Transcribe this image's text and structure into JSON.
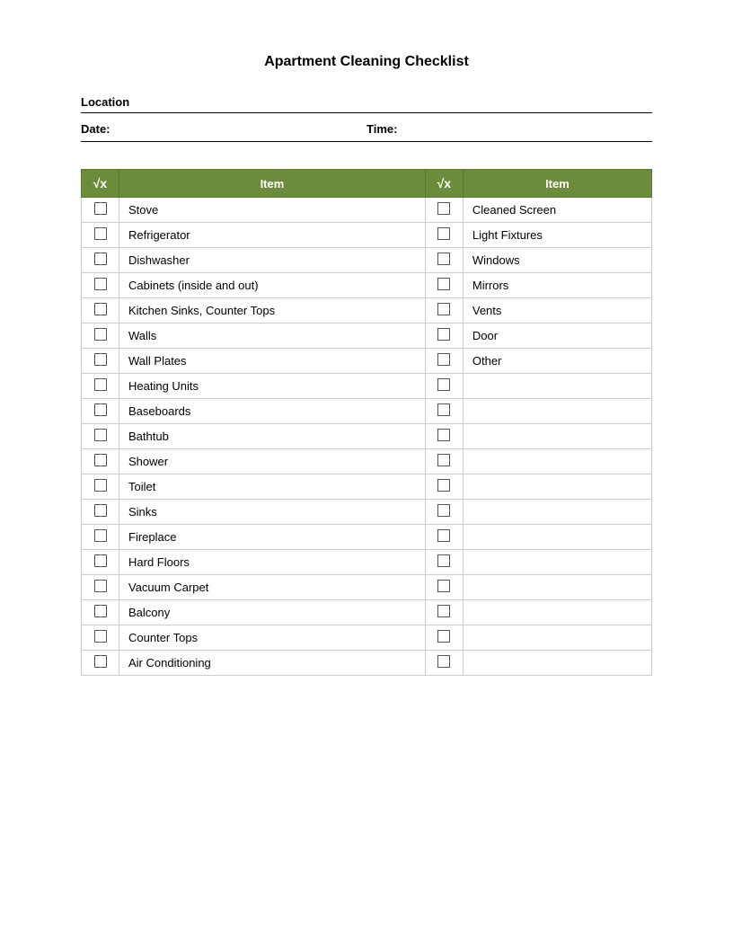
{
  "title": "Apartment Cleaning Checklist",
  "location_label": "Location",
  "date_label": "Date:",
  "time_label": "Time:",
  "table": {
    "header": {
      "check_symbol": "√x",
      "item_label": "Item"
    },
    "left_items": [
      "Stove",
      "Refrigerator",
      "Dishwasher",
      "Cabinets (inside and out)",
      "Kitchen Sinks, Counter Tops",
      "Walls",
      "Wall Plates",
      "Heating Units",
      "Baseboards",
      "Bathtub",
      "Shower",
      "Toilet",
      "Sinks",
      "Fireplace",
      "Hard Floors",
      "Vacuum Carpet",
      "Balcony",
      "Counter Tops",
      "Air Conditioning"
    ],
    "right_items": [
      "Cleaned Screen",
      "Light Fixtures",
      "Windows",
      "Mirrors",
      "Vents",
      "Door",
      "Other",
      "",
      "",
      "",
      "",
      "",
      "",
      "",
      "",
      "",
      "",
      "",
      ""
    ]
  }
}
